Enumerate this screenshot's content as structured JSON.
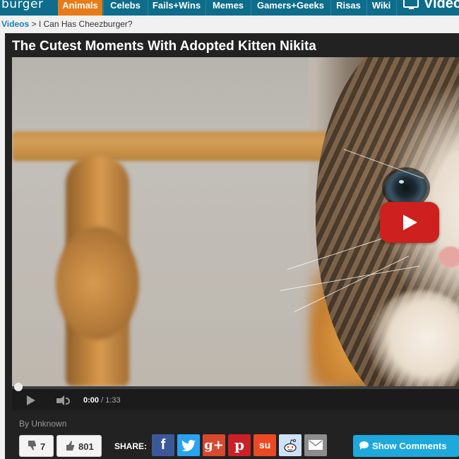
{
  "nav": {
    "logo": "burger",
    "items": [
      {
        "label": "Animals",
        "active": true
      },
      {
        "label": "Celebs"
      },
      {
        "label": "Fails+Wins"
      },
      {
        "label": "Memes"
      },
      {
        "label": "Gamers+Geeks"
      },
      {
        "label": "Risas"
      },
      {
        "label": "Wiki"
      }
    ],
    "videos_label": "Videos"
  },
  "breadcrumb": {
    "link": "Videos",
    "separator": ">",
    "current": "I Can Has Cheezburger?"
  },
  "post": {
    "title": "The Cutest Moments With Adopted Kitten Nikita",
    "byline": "By Unknown"
  },
  "player": {
    "current_time": "0:00",
    "separator": "/",
    "duration": "1:33",
    "progress": 0
  },
  "votes": {
    "down_count": "7",
    "up_count": "801"
  },
  "share": {
    "label": "SHARE:",
    "buttons": [
      {
        "name": "facebook",
        "glyph": "f"
      },
      {
        "name": "twitter",
        "glyph": ""
      },
      {
        "name": "google-plus",
        "glyph": "g+"
      },
      {
        "name": "pinterest",
        "glyph": "p"
      },
      {
        "name": "stumbleupon",
        "glyph": "su"
      },
      {
        "name": "reddit",
        "glyph": ""
      },
      {
        "name": "email",
        "glyph": ""
      }
    ]
  },
  "comments": {
    "label": "Show Comments"
  },
  "colors": {
    "nav_bg": "#0d6d8a",
    "nav_active": "#e87b19",
    "card_bg": "#222222",
    "comments_button": "#1ea9dd",
    "youtube_red": "#cd201f"
  }
}
